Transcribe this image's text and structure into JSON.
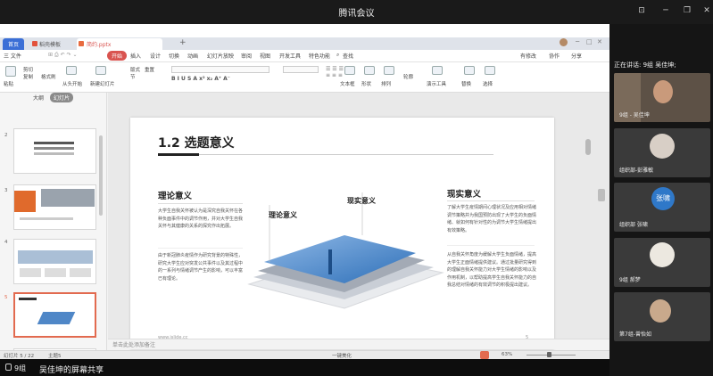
{
  "app_title": "腾讯会议",
  "wps_tabs": [
    {
      "label": "首页"
    },
    {
      "label": "稻壳模板"
    },
    {
      "label": "简约.pptx"
    }
  ],
  "tab_new": "+",
  "menu": [
    "三 文件",
    "开始",
    "插入",
    "设计",
    "切换",
    "动画",
    "幻灯片放映",
    "审阅",
    "视图",
    "开发工具",
    "特色功能",
    "查找"
  ],
  "menu_right": [
    "有修改",
    "协作",
    "分享"
  ],
  "ribbon": {
    "paste": "粘贴",
    "cut": "剪切",
    "copy": "复制",
    "format": "格式刷",
    "from_start": "从头开始",
    "new_slide": "新建幻灯片",
    "layout": "版式",
    "section": "节",
    "reset": "重置",
    "textbox": "文本框",
    "shape": "形状",
    "arrange": "排列",
    "outline": "轮廓",
    "present": "演示工具",
    "replace": "替换",
    "select": "选择"
  },
  "left_tabs": [
    "大纲",
    "幻灯片"
  ],
  "thumbnails": [
    {
      "num": "2"
    },
    {
      "num": "3"
    },
    {
      "num": "4"
    },
    {
      "num": "5"
    },
    {
      "num": "6"
    }
  ],
  "add_slide": "+",
  "slide": {
    "title": "1.2 选题意义",
    "theory_heading": "理论意义",
    "theory_p1": "大学生自我关怀被认为是深究自我关怀在各种负面事件中的调节作用，并对大学生自我关怀与其健康的关系的探究作出拓展。",
    "theory_p2": "由于新冠肺炎疫情作为研究背景的特殊性，研究大学生应对突发公共事件以及其过程中的一系列与情绪调节产生的影响，可以丰富已有理论。",
    "practice_heading": "现实意义",
    "practice_p1": "了解大学生疫情期间心理状况及应用相对情绪调节策略并为我国预防出现了大学生的负面情绪、就如何有针对性的为调节大学生情绪提出有效策略。",
    "practice_p2": "从自我关怀角度为缓解大学生负面情绪，提高大学生正面情绪提供建议。通过批量研究得到的理解自我关怀能力对大学生情绪的影响以及作用机制，以帮助提高学生自我关怀能力的自我总结对情绪的有效调节的积极提出建议。",
    "diagram_label_a": "理论意义",
    "diagram_label_b": "现实意义",
    "footer_left": "www.islide.cc",
    "page_no": "5"
  },
  "notes_placeholder": "单击此处添加备注",
  "status": {
    "slide_pos": "幻灯片 5 / 22",
    "theme": "主题5",
    "beautify": "一键美化",
    "zoom": "63%"
  },
  "speaking": "正在讲话: 9组 吴佳坤;",
  "participants": [
    {
      "name": "9组 - 吴佳坤",
      "photo": "user-photo"
    },
    {
      "name": "组织部-彭雅敏",
      "photo": "user-photo"
    },
    {
      "name": "组织部 张啸",
      "photo": "avatar-initial",
      "initial": "张啸",
      "color": "#2f78c8"
    },
    {
      "name": "9组 郝梦",
      "photo": "user-photo"
    },
    {
      "name": "第7组-曾怡如",
      "photo": "user-photo"
    }
  ],
  "bottom_share": "9组",
  "bottom_title": "吴佳坤的屏幕共享"
}
